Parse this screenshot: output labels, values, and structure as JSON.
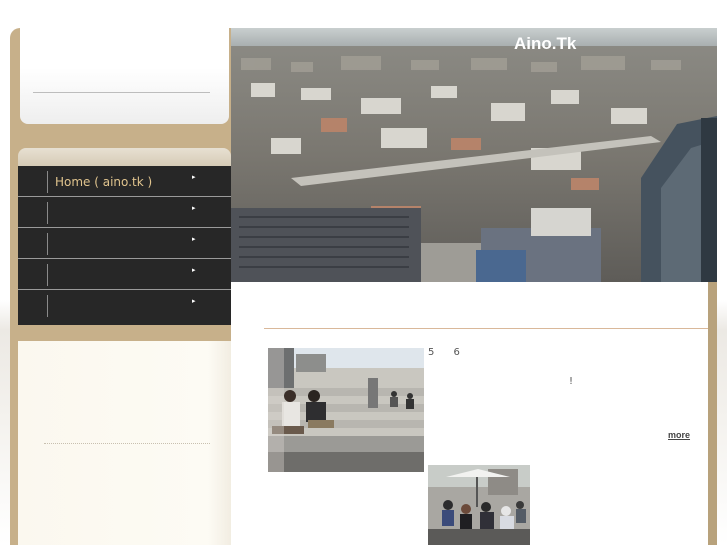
{
  "site": {
    "title": "Aino.Tk"
  },
  "nav": {
    "items": [
      {
        "label": "Home ( aino.tk )",
        "arrow": "▸"
      },
      {
        "label": "",
        "arrow": "▸"
      },
      {
        "label": "",
        "arrow": "▸"
      },
      {
        "label": "",
        "arrow": "▸"
      },
      {
        "label": "",
        "arrow": "▸"
      }
    ]
  },
  "post": {
    "date": "5 6",
    "exclamation": "!",
    "more_label": "more"
  },
  "colors": {
    "accent_gold": "#e0c48e",
    "nav_bg": "#272727",
    "frame_tan": "#c7b08a",
    "rule": "#d9b89a"
  }
}
